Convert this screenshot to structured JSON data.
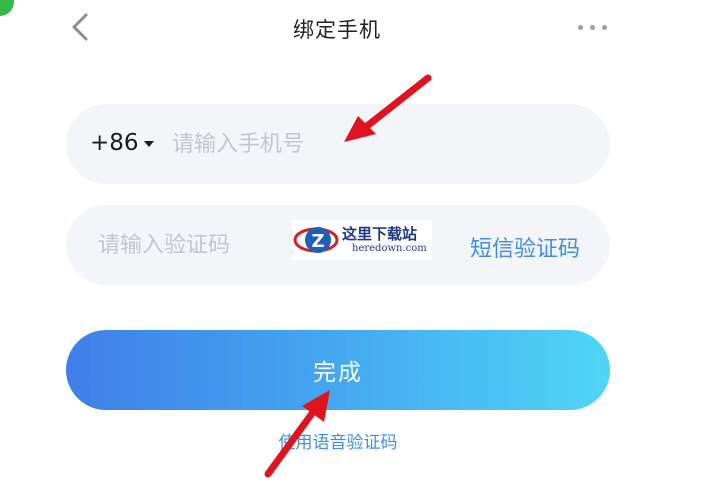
{
  "header": {
    "back_icon": "chevron-left-icon",
    "title": "绑定手机",
    "more_icon": "ellipsis-icon"
  },
  "phone_field": {
    "country_code": "+86",
    "placeholder": "请输入手机号",
    "value": ""
  },
  "code_field": {
    "placeholder": "请输入验证码",
    "value": "",
    "sms_button": "短信验证码"
  },
  "submit": {
    "label": "完成"
  },
  "voice_link": {
    "label": "使用语音验证码"
  },
  "watermark": {
    "brand": "这里下载站",
    "domain": "heredown.com"
  },
  "colors": {
    "accent": "#3f8fe6",
    "button_gradient_start": "#3f7fe9",
    "button_gradient_end": "#4fd6f6",
    "field_bg": "#f3f5f9",
    "annotation_arrow": "#e0141e"
  }
}
